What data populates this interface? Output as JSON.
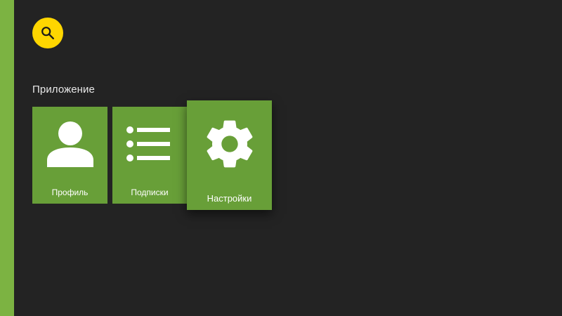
{
  "app": {
    "accent_color": "#7cb342",
    "card_color": "#689f38",
    "background_color": "#232323"
  },
  "search": {
    "icon": "search-icon",
    "color": "#ffd600"
  },
  "section": {
    "title": "Приложение"
  },
  "cards": [
    {
      "label": "Профиль",
      "icon": "person-icon",
      "focused": false
    },
    {
      "label": "Подписки",
      "icon": "list-icon",
      "focused": false
    },
    {
      "label": "Настройки",
      "icon": "settings-icon",
      "focused": true
    }
  ]
}
